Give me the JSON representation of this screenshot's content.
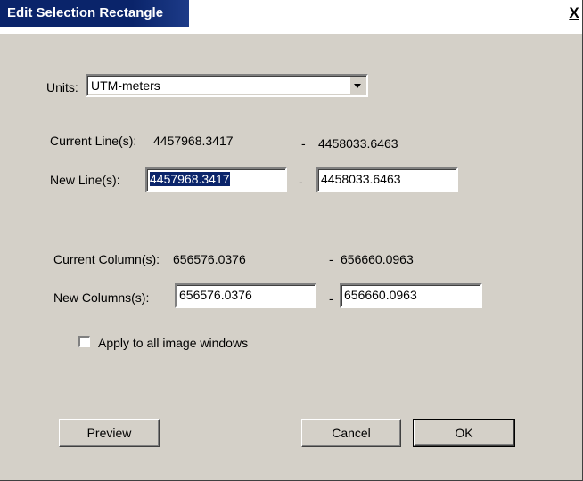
{
  "window": {
    "title": "Edit Selection Rectangle",
    "close_label": "X"
  },
  "units": {
    "label": "Units:",
    "selected": "UTM-meters"
  },
  "lines": {
    "current_label": "Current Line(s):",
    "current_start": "4457968.3417",
    "current_sep": "-",
    "current_end": "4458033.6463",
    "new_label": "New Line(s):",
    "new_start": "4457968.3417",
    "new_sep": "-",
    "new_end": "4458033.6463"
  },
  "columns": {
    "current_label": "Current Column(s):",
    "current_start": "656576.0376",
    "current_sep": "-",
    "current_end": "656660.0963",
    "new_label": "New Columns(s):",
    "new_start": "656576.0376",
    "new_sep": "-",
    "new_end": "656660.0963"
  },
  "apply_all": {
    "label": "Apply to all image windows",
    "checked": false
  },
  "buttons": {
    "preview": "Preview",
    "cancel": "Cancel",
    "ok": "OK"
  }
}
